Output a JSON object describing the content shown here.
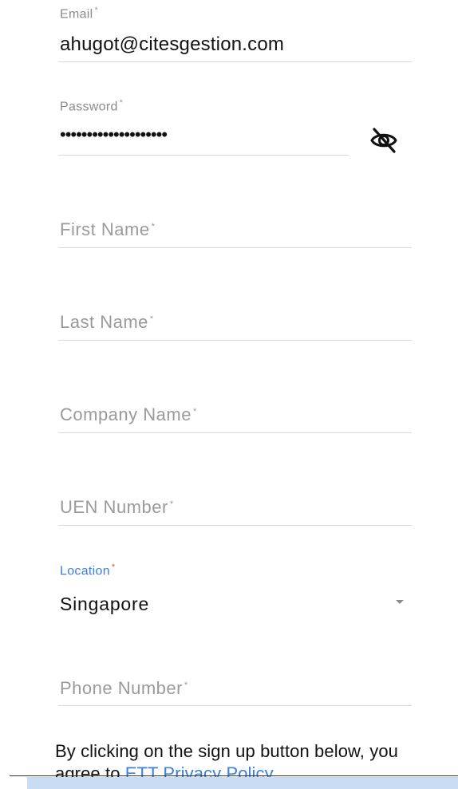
{
  "form": {
    "email": {
      "label": "Email",
      "value": "ahugot@citesgestion.com"
    },
    "password": {
      "label": "Password",
      "value": "••••••••••••••••••••",
      "visibility_icon": "eye-off-icon"
    },
    "first_name": {
      "placeholder": "First Name"
    },
    "last_name": {
      "placeholder": "Last Name"
    },
    "company_name": {
      "placeholder": "Company Name"
    },
    "uen_number": {
      "placeholder": "UEN Number"
    },
    "location": {
      "label": "Location",
      "value": "Singapore",
      "caret_icon": "caret-down-icon"
    },
    "phone_number": {
      "placeholder": "Phone Number"
    },
    "required_mark": "*"
  },
  "consent": {
    "text": "By clicking on the sign up button below, you agree to ",
    "link_label": "ETT Privacy Policy"
  },
  "colors": {
    "accent": "#3d7fe0",
    "required_accent": "#d94c4c",
    "underline": "#d9d9d9",
    "bottom_band": "#c9dcf3"
  }
}
